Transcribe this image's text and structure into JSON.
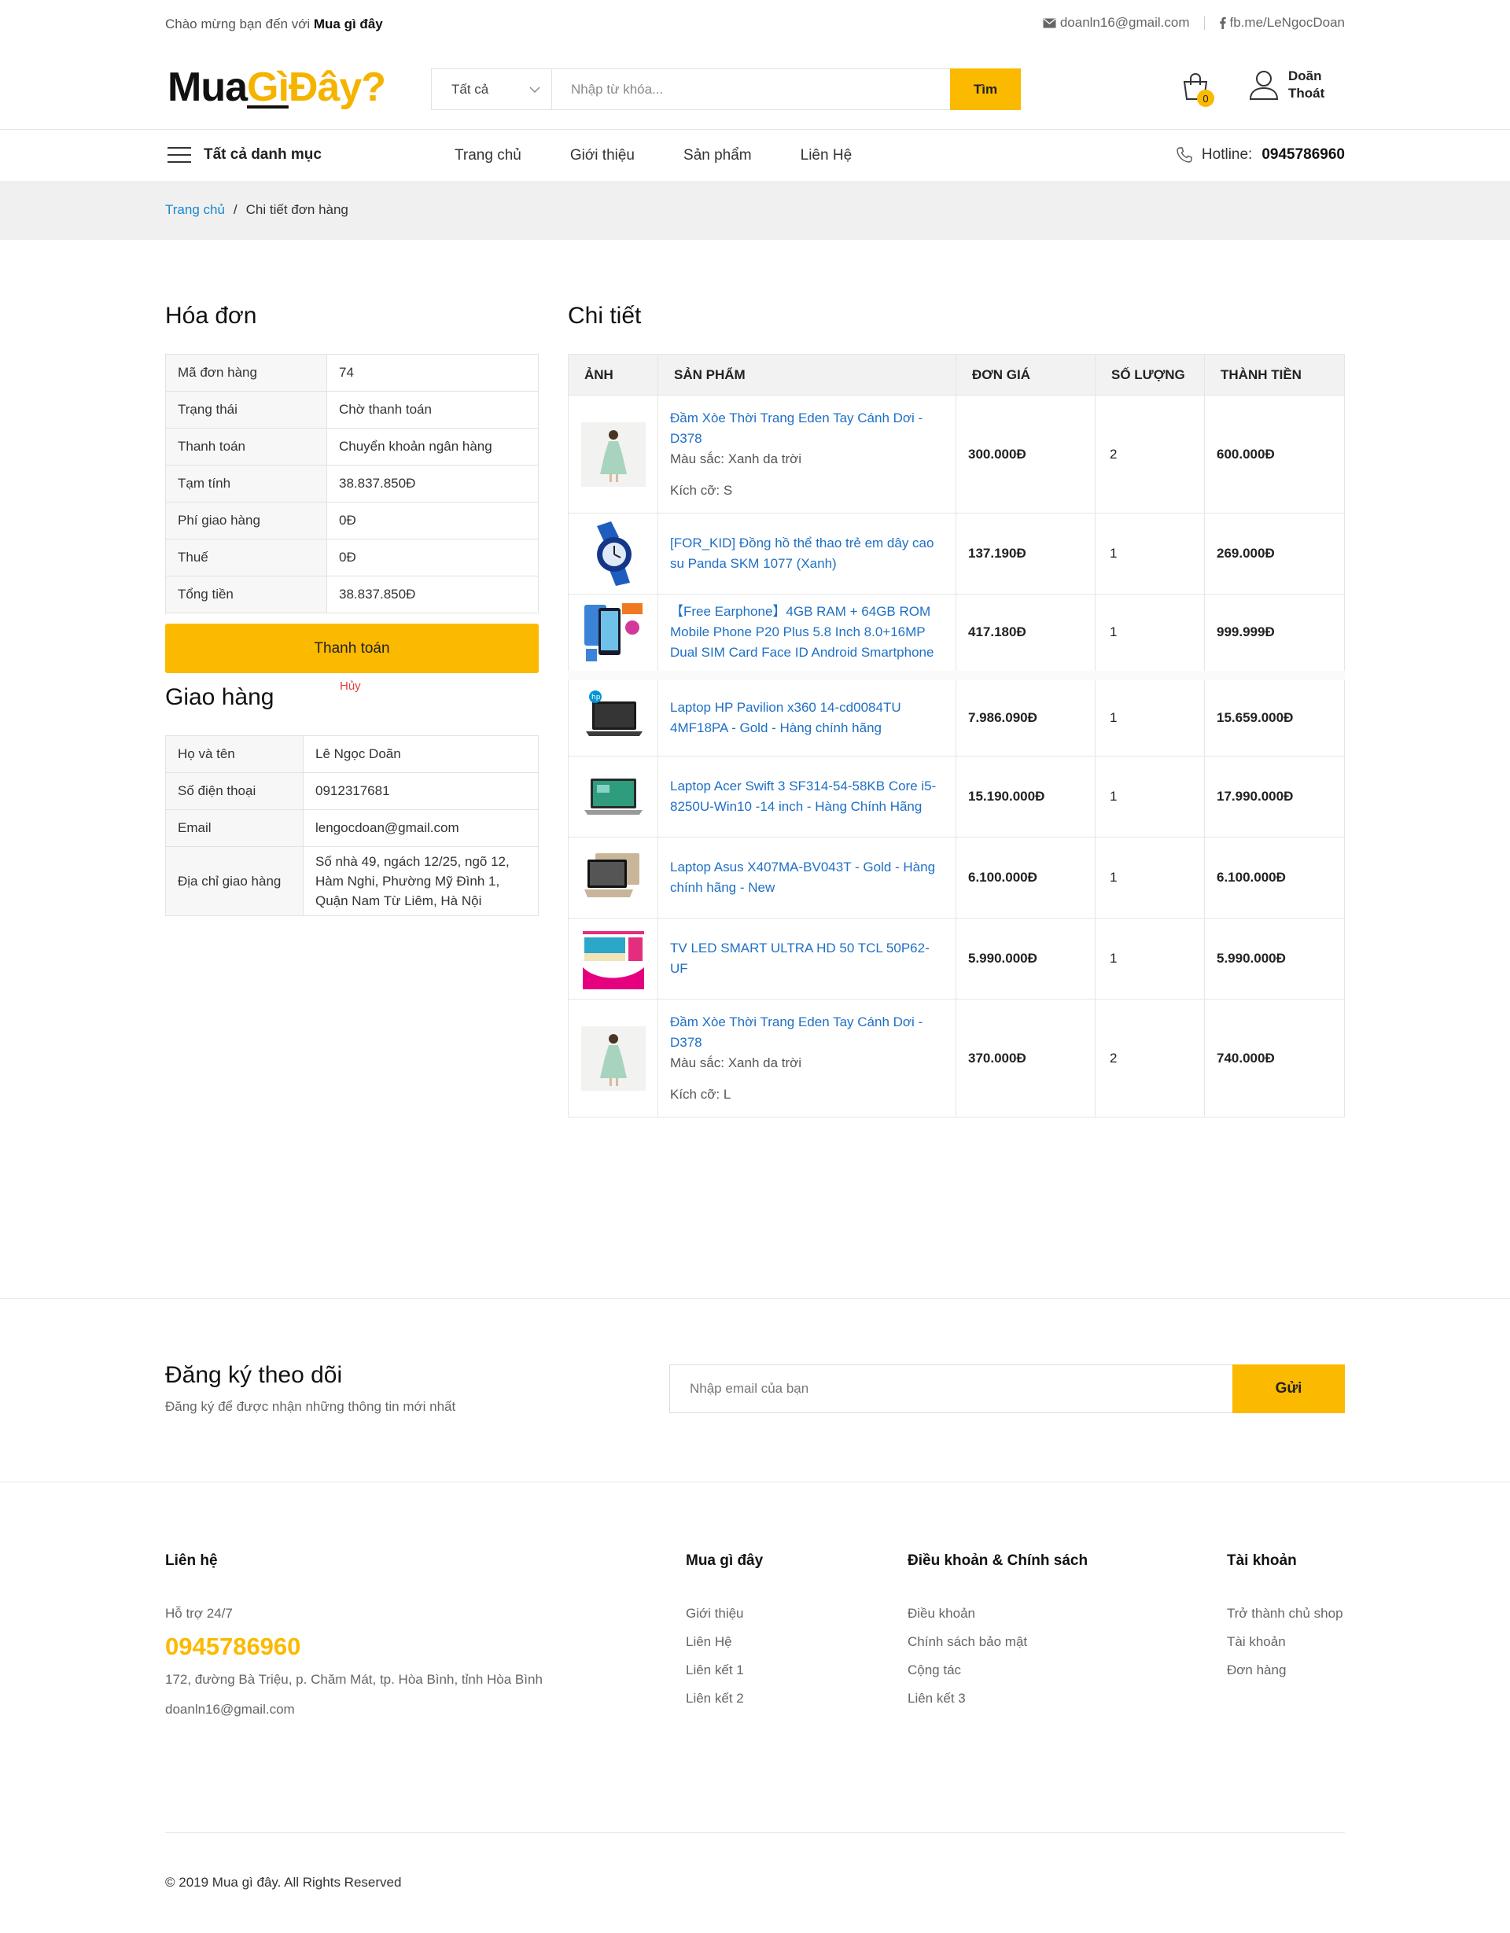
{
  "topbar": {
    "welcome_prefix": "Chào mừng bạn đến với",
    "welcome_brand": "Mua gì đây",
    "email": "doanln16@gmail.com",
    "facebook": "fb.me/LeNgocDoan"
  },
  "logo": {
    "part1": "Mua",
    "part2": "Gì",
    "part3": "Đây?"
  },
  "search": {
    "category": "Tất cả",
    "placeholder": "Nhập từ khóa...",
    "button": "Tìm"
  },
  "cart": {
    "count": "0"
  },
  "user": {
    "name": "Doãn",
    "logout": "Thoát"
  },
  "nav": {
    "all_categories": "Tất cả danh mục",
    "menu": [
      "Trang chủ",
      "Giới thiệu",
      "Sản phẩm",
      "Liên Hệ"
    ],
    "hotline_label": "Hotline:",
    "hotline": "0945786960"
  },
  "breadcrumb": {
    "home": "Trang chủ",
    "sep": "/",
    "current": "Chi tiết đơn hàng"
  },
  "invoice": {
    "title": "Hóa đơn",
    "rows": [
      {
        "k": "Mã đơn hàng",
        "v": "74"
      },
      {
        "k": "Trạng thái",
        "v": "Chờ thanh toán"
      },
      {
        "k": "Thanh toán",
        "v": "Chuyển khoản ngân hàng"
      },
      {
        "k": "Tạm tính",
        "v": "38.837.850Đ"
      },
      {
        "k": "Phí giao hàng",
        "v": "0Đ"
      },
      {
        "k": "Thuế",
        "v": "0Đ"
      },
      {
        "k": "Tổng tiền",
        "v": "38.837.850Đ"
      }
    ],
    "pay_button": "Thanh toán",
    "cancel": "Hủy"
  },
  "shipping": {
    "title": "Giao hàng",
    "rows": [
      {
        "k": "Họ và tên",
        "v": "Lê Ngọc Doãn"
      },
      {
        "k": "Số điện thoại",
        "v": "0912317681"
      },
      {
        "k": "Email",
        "v": "lengocdoan@gmail.com"
      },
      {
        "k": "Địa chỉ giao hàng",
        "v": "Số nhà 49, ngách 12/25, ngõ 12, Hàm Nghi, Phường Mỹ Đình 1, Quận Nam Từ Liêm, Hà Nội"
      }
    ]
  },
  "detail": {
    "title": "Chi tiết",
    "headers": [
      "ẢNH",
      "SẢN PHẨM",
      "ĐƠN GIÁ",
      "SỐ LƯỢNG",
      "THÀNH TIỀN"
    ],
    "rows": [
      {
        "icon": "dress-thumb",
        "name": "Đầm Xòe Thời Trang Eden Tay Cánh Dơi - D378",
        "color": "Màu sắc: Xanh da trời",
        "size": "Kích cỡ: S",
        "price": "300.000Đ",
        "qty": "2",
        "total": "600.000Đ"
      },
      {
        "icon": "watch-thumb",
        "name": "[FOR_KID] Đồng hồ thể thao trẻ em dây cao su Panda SKM 1077 (Xanh)",
        "color": "",
        "size": "",
        "price": "137.190Đ",
        "qty": "1",
        "total": "269.000Đ"
      },
      {
        "icon": "phone-thumb",
        "name": "【Free Earphone】4GB RAM + 64GB ROM Mobile Phone P20 Plus 5.8 Inch 8.0+16MP Dual SIM Card Face ID Android Smartphone",
        "color": "",
        "size": "",
        "price": "417.180Đ",
        "qty": "1",
        "total": "999.999Đ"
      },
      {
        "icon": "laptop-hp-thumb",
        "name": "Laptop HP Pavilion x360 14-cd0084TU 4MF18PA - Gold - Hàng chính hãng",
        "color": "",
        "size": "",
        "price": "7.986.090Đ",
        "qty": "1",
        "total": "15.659.000Đ"
      },
      {
        "icon": "laptop-acer-thumb",
        "name": "Laptop Acer Swift 3 SF314-54-58KB Core i5-8250U-Win10 -14 inch - Hàng Chính Hãng",
        "color": "",
        "size": "",
        "price": "15.190.000Đ",
        "qty": "1",
        "total": "17.990.000Đ"
      },
      {
        "icon": "laptop-asus-thumb",
        "name": "Laptop Asus X407MA-BV043T - Gold - Hàng chính hãng - New",
        "color": "",
        "size": "",
        "price": "6.100.000Đ",
        "qty": "1",
        "total": "6.100.000Đ"
      },
      {
        "icon": "tv-thumb",
        "name": "TV LED SMART ULTRA HD 50 TCL 50P62-UF",
        "color": "",
        "size": "",
        "price": "5.990.000Đ",
        "qty": "1",
        "total": "5.990.000Đ"
      },
      {
        "icon": "dress-thumb",
        "name": "Đầm Xòe Thời Trang Eden Tay Cánh Dơi - D378",
        "color": "Màu sắc: Xanh da trời",
        "size": "Kích cỡ: L",
        "price": "370.000Đ",
        "qty": "2",
        "total": "740.000Đ"
      }
    ]
  },
  "newsletter": {
    "title": "Đăng ký theo dõi",
    "subtitle": "Đăng ký để được nhận những thông tin mới nhất",
    "placeholder": "Nhập email của bạn",
    "button": "Gửi"
  },
  "footer": {
    "contact": {
      "title": "Liên hệ",
      "support": "Hỗ trợ 24/7",
      "phone": "0945786960",
      "address": "172, đường Bà Triệu, p. Chăm Mát, tp. Hòa Bình, tỉnh Hòa Bình",
      "email": "doanln16@gmail.com"
    },
    "col_brand": {
      "title": "Mua gì đây",
      "links": [
        "Giới thiệu",
        "Liên Hệ",
        "Liên kết 1",
        "Liên kết 2"
      ]
    },
    "col_policy": {
      "title": "Điều khoản & Chính sách",
      "links": [
        "Điều khoản",
        "Chính sách bảo mật",
        "Cộng tác",
        "Liên kết 3"
      ]
    },
    "col_account": {
      "title": "Tài khoản",
      "links": [
        "Trở thành chủ shop",
        "Tài khoản",
        "Đơn hàng"
      ]
    },
    "copyright": "© 2019 Mua gì đây. All Rights Reserved"
  },
  "colors": {
    "accent": "#fbb900",
    "link": "#1f6fc5",
    "danger": "#e43d3d"
  }
}
